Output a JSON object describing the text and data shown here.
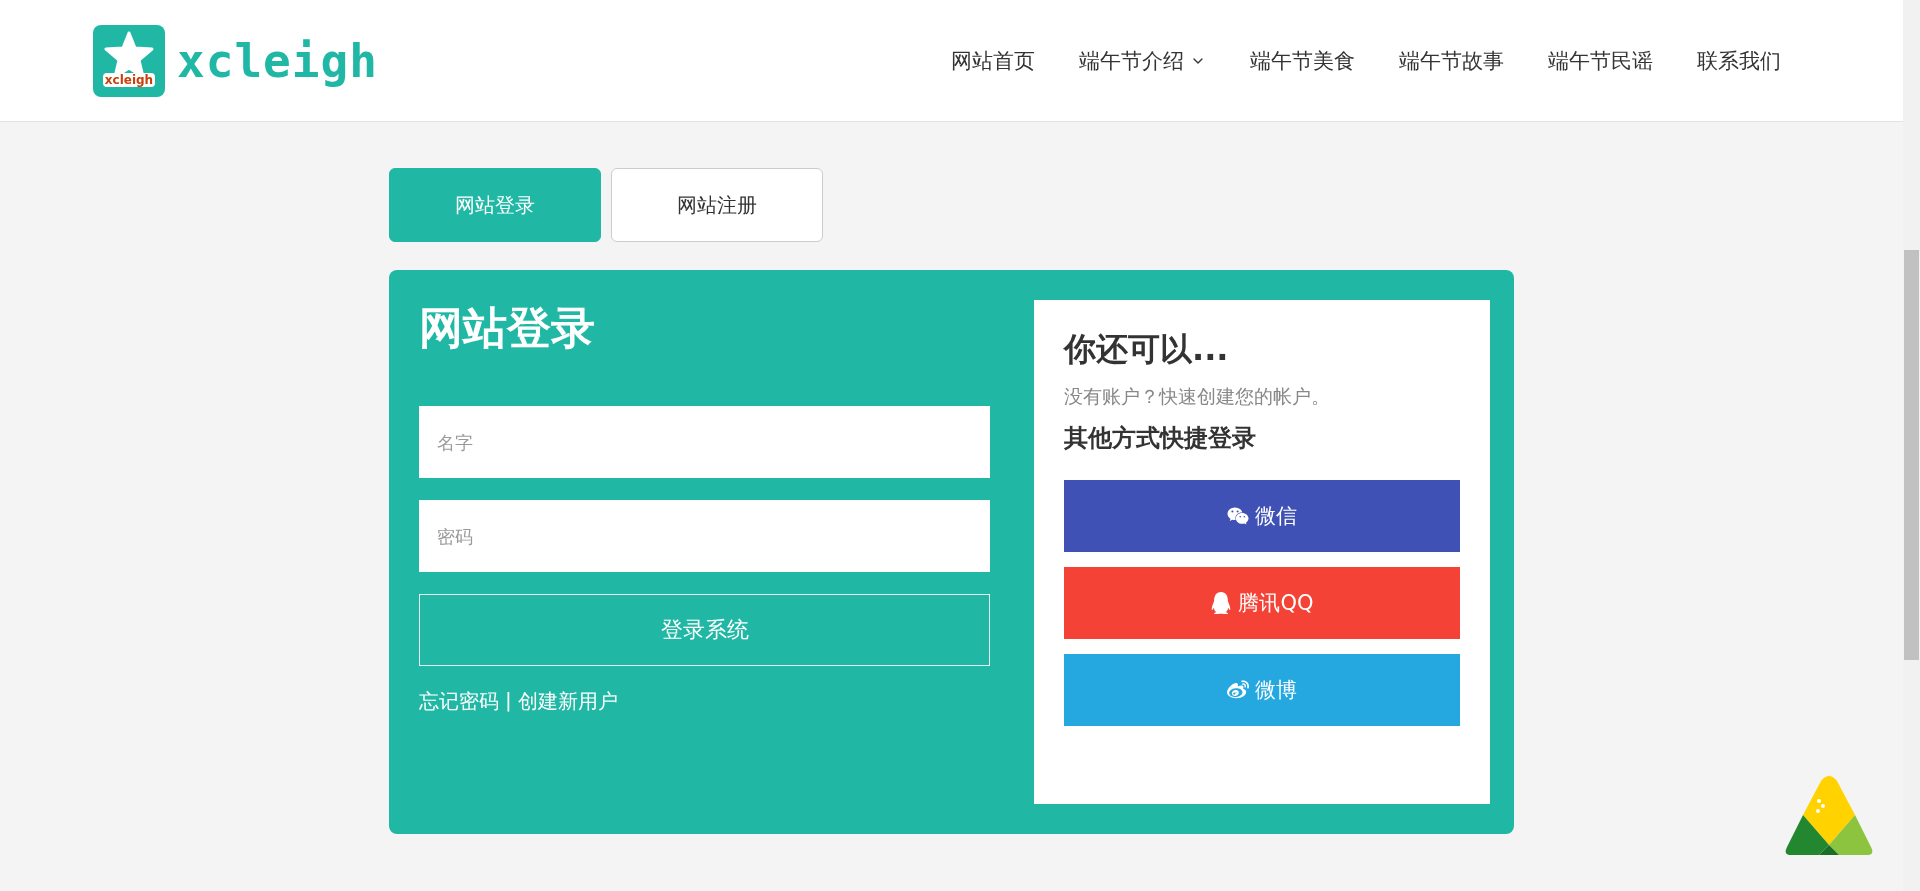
{
  "header": {
    "logo": {
      "badge_text": "xcleigh",
      "wordmark": "xcleigh"
    },
    "nav": [
      {
        "label": "网站首页",
        "has_dropdown": false
      },
      {
        "label": "端午节介绍",
        "has_dropdown": true
      },
      {
        "label": "端午节美食",
        "has_dropdown": false
      },
      {
        "label": "端午节故事",
        "has_dropdown": false
      },
      {
        "label": "端午节民谣",
        "has_dropdown": false
      },
      {
        "label": "联系我们",
        "has_dropdown": false
      }
    ]
  },
  "tabs": [
    {
      "label": "网站登录",
      "selected": true
    },
    {
      "label": "网站注册",
      "selected": false
    }
  ],
  "login": {
    "title": "网站登录",
    "fields": [
      {
        "placeholder": "名字"
      },
      {
        "placeholder": "密码"
      }
    ],
    "submit": "登录系统",
    "links": [
      {
        "label": "忘记密码"
      },
      {
        "label": "创建新用户"
      }
    ],
    "separator": "|"
  },
  "alternatives": {
    "title": "你还可以...",
    "subtitle": "没有账户？快速创建您的帐户。",
    "social_title": "其他方式快捷登录",
    "buttons": [
      {
        "label": "微信",
        "kind": "wechat",
        "color": "#3f51b5"
      },
      {
        "label": "腾讯QQ",
        "kind": "qq",
        "color": "#f44336"
      },
      {
        "label": "微博",
        "kind": "weibo",
        "color": "#25a8e0"
      }
    ]
  }
}
